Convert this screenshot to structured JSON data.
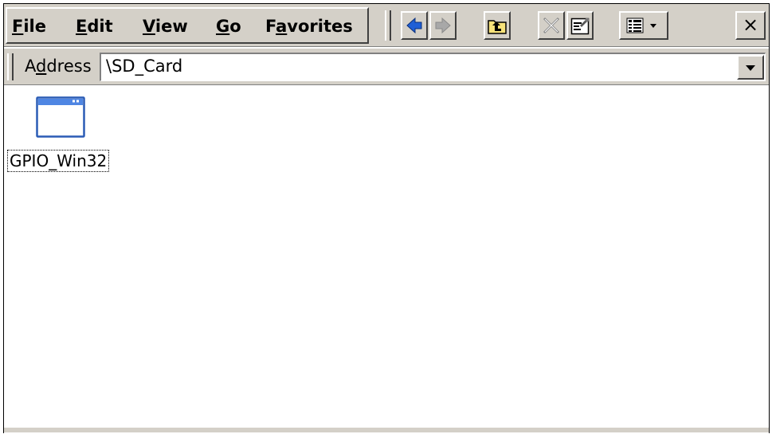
{
  "menu": {
    "items": [
      {
        "mnemonic": "F",
        "rest": "ile"
      },
      {
        "mnemonic": "E",
        "rest": "dit"
      },
      {
        "mnemonic": "V",
        "rest": "iew"
      },
      {
        "mnemonic": "G",
        "rest": "o"
      },
      {
        "prefix": "F",
        "mnemonic": "a",
        "rest": "vorites"
      }
    ]
  },
  "toolbar": {
    "buttons": [
      "back-icon",
      "forward-icon",
      "up-folder-icon",
      "delete-icon",
      "properties-icon",
      "views-icon"
    ],
    "close_label": "×"
  },
  "address": {
    "label_prefix": "A",
    "label_mnemonic": "d",
    "label_rest": "dress",
    "value": "\\SD_Card"
  },
  "files": [
    {
      "name": "GPIO_Win32",
      "icon": "application-window-icon"
    }
  ],
  "colors": {
    "chrome": "#d4d0c8",
    "back_arrow": "#1f5fd6",
    "forward_arrow": "#9a9a9a"
  }
}
